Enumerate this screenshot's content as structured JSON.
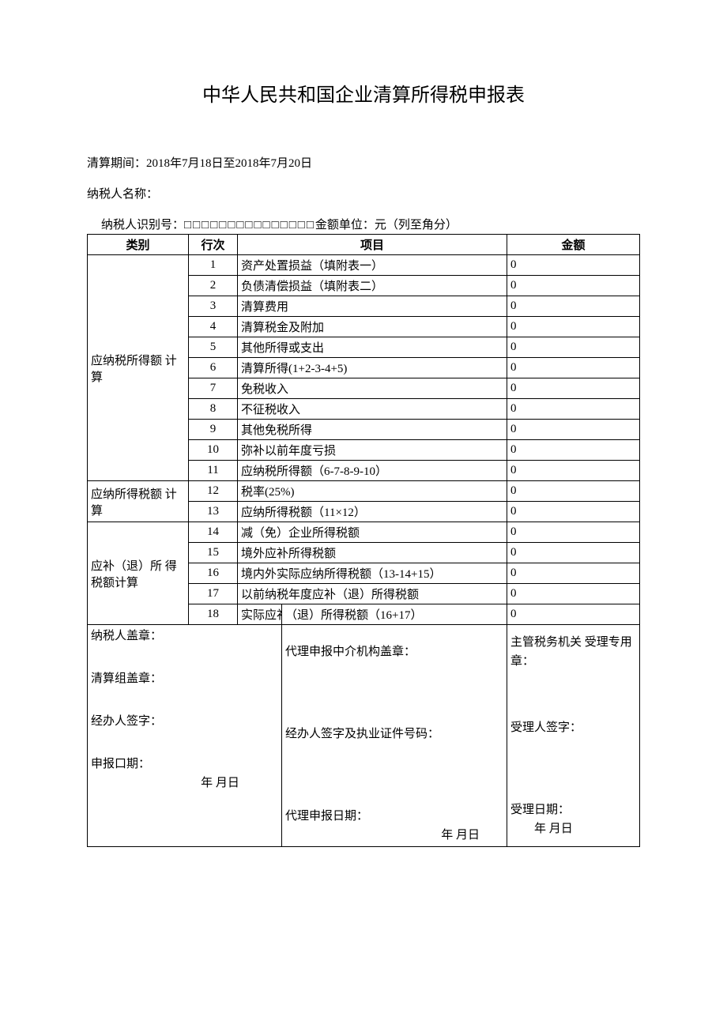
{
  "title": "中华人民共和国企业清算所得税申报表",
  "period": {
    "label": "清算期间：",
    "value": "2018年7月18日至2018年7月20日"
  },
  "taxpayer_name": {
    "label": "纳税人名称：",
    "value": ""
  },
  "taxpayer_id": {
    "label": "纳税人识别号：",
    "boxes": "□□□□□□□□□□□□□□□",
    "unit_label": "金额单位：元（列至角分）"
  },
  "headers": {
    "category": "类别",
    "row": "行次",
    "item": "项目",
    "amount": "金额"
  },
  "sections": [
    {
      "category": "应纳税所得额 计算",
      "rows": [
        {
          "num": "1",
          "item": "资产处置损益（填附表一）",
          "amount": "0"
        },
        {
          "num": "2",
          "item": "负债清偿损益（填附表二）",
          "amount": "0"
        },
        {
          "num": "3",
          "item": "清算费用",
          "amount": "0"
        },
        {
          "num": "4",
          "item": "清算税金及附加",
          "amount": "0"
        },
        {
          "num": "5",
          "item": "其他所得或支出",
          "amount": "0"
        },
        {
          "num": "6",
          "item": "清算所得(1+2-3-4+5)",
          "amount": "0"
        },
        {
          "num": "7",
          "item": "免税收入",
          "amount": "0"
        },
        {
          "num": "8",
          "item": "不征税收入",
          "amount": "0"
        },
        {
          "num": "9",
          "item": "其他免税所得",
          "amount": "0"
        },
        {
          "num": "10",
          "item": "弥补以前年度亏损",
          "amount": "0"
        },
        {
          "num": "11",
          "item": "应纳税所得额（6-7-8-9-10）",
          "amount": "0"
        }
      ]
    },
    {
      "category": "应纳所得税额 计算",
      "rows": [
        {
          "num": "12",
          "item": "税率(25%)",
          "amount": "0"
        },
        {
          "num": "13",
          "item": "应纳所得税额（11×12）",
          "amount": "0"
        }
      ]
    },
    {
      "category": "应补（退）所 得税额计算",
      "rows": [
        {
          "num": "14",
          "item": "减（免）企业所得税额",
          "amount": "0"
        },
        {
          "num": "15",
          "item": "境外应补所得税额",
          "amount": "0"
        },
        {
          "num": "16",
          "item": "境内外实际应纳所得税额（13-14+15）",
          "amount": "0"
        },
        {
          "num": "17",
          "item": "以前纳税年度应补（退）所得税额",
          "amount": "0"
        }
      ]
    }
  ],
  "row18": {
    "num": "18",
    "prefix": "实际应补",
    "suffix": "（退）所得税额（16+17）",
    "amount": "0"
  },
  "footer": {
    "left": {
      "l1": "纳税人盖章：",
      "l2": "清算组盖章：",
      "l3": "经办人签字：",
      "l4": "申报口期：",
      "l5": "年 月日"
    },
    "mid": {
      "m1": "代理申报中介机构盖章：",
      "m2": "经办人签字及执业证件号码：",
      "m3": "代理申报日期：",
      "m4": "年 月日"
    },
    "right": {
      "r1": "主管税务机关 受理专用章：",
      "r2": "受理人签字：",
      "r3": "受理日期：",
      "r4": "年 月日"
    }
  }
}
